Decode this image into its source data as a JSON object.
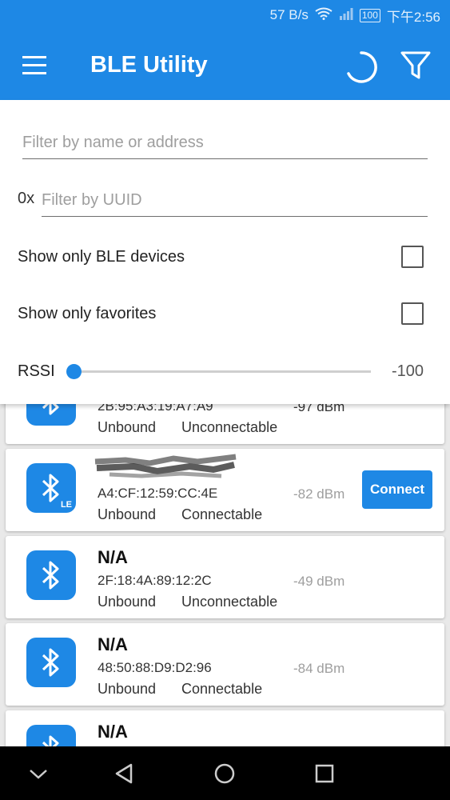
{
  "status_bar": {
    "network_speed": "57 B/s",
    "battery": "100",
    "time": "下午2:56"
  },
  "toolbar": {
    "title": "BLE Utility",
    "icons": [
      "menu-icon",
      "refresh-icon",
      "filter-icon"
    ]
  },
  "filters": {
    "name_placeholder": "Filter by name or address",
    "uuid_prefix": "0x",
    "uuid_placeholder": "Filter by UUID",
    "ble_only_label": "Show only BLE devices",
    "ble_only_checked": false,
    "favorites_label": "Show only favorites",
    "favorites_checked": false,
    "rssi_label": "RSSI",
    "rssi_value": "-100"
  },
  "devices": [
    {
      "name": "",
      "address": "2B:95:A3:19:A7:A9",
      "bond": "Unbound",
      "connectable": "Unconnectable",
      "rssi": "-97 dBm",
      "le": false,
      "has_connect": false
    },
    {
      "name": "",
      "address": "A4:CF:12:59:CC:4E",
      "bond": "Unbound",
      "connectable": "Connectable",
      "rssi": "-82 dBm",
      "le": true,
      "has_connect": true,
      "connect_label": "Connect"
    },
    {
      "name": "N/A",
      "address": "2F:18:4A:89:12:2C",
      "bond": "Unbound",
      "connectable": "Unconnectable",
      "rssi": "-49 dBm",
      "le": false,
      "has_connect": false
    },
    {
      "name": "N/A",
      "address": "48:50:88:D9:D2:96",
      "bond": "Unbound",
      "connectable": "Connectable",
      "rssi": "-84 dBm",
      "le": false,
      "has_connect": false
    },
    {
      "name": "N/A",
      "address": "",
      "bond": "",
      "connectable": "",
      "rssi": "",
      "le": false,
      "has_connect": false
    }
  ],
  "colors": {
    "primary": "#1e88e5",
    "navbar": "#000000"
  }
}
